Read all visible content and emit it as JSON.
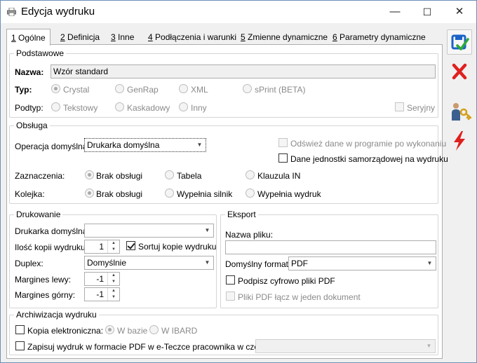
{
  "window": {
    "title": "Edycja wydruku",
    "minimize": "—",
    "maximize": "☐",
    "close": "✕"
  },
  "tabs": [
    {
      "key": "1",
      "label": " Ogólne"
    },
    {
      "key": "2",
      "label": " Definicja"
    },
    {
      "key": "3",
      "label": " Inne"
    },
    {
      "key": "4",
      "label": " Podłączenia i warunki"
    },
    {
      "key": "5",
      "label": " Zmienne dynamiczne"
    },
    {
      "key": "6",
      "label": " Parametry dynamiczne"
    }
  ],
  "podstawowe": {
    "title": "Podstawowe",
    "nazwa_label": "Nazwa:",
    "nazwa_value": "Wzór standard",
    "typ_label": "Typ:",
    "typ_options": [
      "Crystal",
      "GenRap",
      "XML",
      "sPrint (BETA)"
    ],
    "typ_selected": "Crystal",
    "podtyp_label": "Podtyp:",
    "podtyp_options": [
      "Tekstowy",
      "Kaskadowy",
      "Inny"
    ],
    "seryjny_label": "Seryjny"
  },
  "obsluga": {
    "title": "Obsługa",
    "operacja_label": "Operacja domyślna:",
    "operacja_value": "Drukarka domyślna",
    "odswiez_label": "Odśwież dane w programie po wykonaniu",
    "dane_jst_label": "Dane jednostki samorządowej na wydruku",
    "zaznaczenia_label": "Zaznaczenia:",
    "zaznaczenia_options": [
      "Brak obsługi",
      "Tabela",
      "Klauzula IN"
    ],
    "zaznaczenia_selected": "Brak obsługi",
    "kolejka_label": "Kolejka:",
    "kolejka_options": [
      "Brak obsługi",
      "Wypełnia silnik",
      "Wypełnia wydruk"
    ],
    "kolejka_selected": "Brak obsługi"
  },
  "drukowanie": {
    "title": "Drukowanie",
    "drukarka_label": "Drukarka domyślna:",
    "drukarka_value": "",
    "ilosc_label": "Ilość kopii wydruku:",
    "ilosc_value": "1",
    "sortuj_label": "Sortuj kopie wydruku",
    "sortuj_checked": true,
    "duplex_label": "Duplex:",
    "duplex_value": "Domyślnie",
    "margines_lewy_label": "Margines lewy:",
    "margines_lewy_value": "-1",
    "margines_gorny_label": "Margines górny:",
    "margines_gorny_value": "-1"
  },
  "eksport": {
    "title": "Eksport",
    "nazwa_pliku_label": "Nazwa pliku:",
    "nazwa_pliku_value": "",
    "format_label": "Domyślny format:",
    "format_value": "PDF",
    "podpisz_label": "Podpisz cyfrowo pliki PDF",
    "pliki_lacz_label": "Pliki PDF łącz w jeden dokument"
  },
  "archiwizacja": {
    "title": "Archiwizacja wydruku",
    "kopia_label": "Kopia elektroniczna:",
    "kopia_options": [
      "W bazie",
      "W IBARD"
    ],
    "kopia_selected": "W bazie",
    "zapisuj_label": "Zapisuj wydruk w formacie PDF w e-Teczce pracownika w części:",
    "zapisuj_value": ""
  },
  "side_actions": [
    "save-icon",
    "cancel-icon",
    "key-user-icon",
    "lightning-icon"
  ],
  "colors": {
    "save": "#1b63c8",
    "cancel": "#e0201e",
    "lightning": "#e0201e"
  }
}
